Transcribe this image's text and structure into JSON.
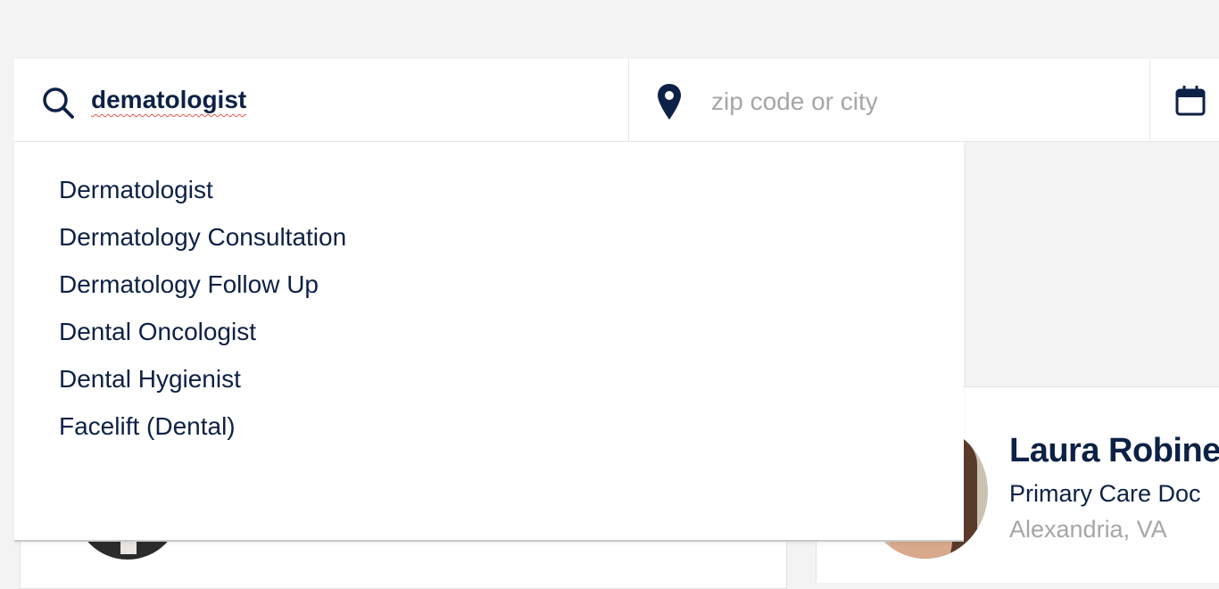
{
  "search": {
    "query": "dematologist",
    "location_placeholder": "zip code or city",
    "location_value": ""
  },
  "suggestions": [
    "Dermatologist",
    "Dermatology Consultation",
    "Dermatology Follow Up",
    "Dental Oncologist",
    "Dental Hygienist",
    "Facelift (Dental)"
  ],
  "provider_card": {
    "name": "Laura Robinet",
    "specialty": "Primary Care Doc",
    "location": "Alexandria, VA"
  },
  "colors": {
    "brand_navy": "#0d2146",
    "placeholder_gray": "#a6a6a6",
    "page_background": "#f3f3f3",
    "spellcheck_red": "#e0584a"
  },
  "icons": {
    "query": "search-icon",
    "location": "map-pin-icon",
    "date": "calendar-icon"
  }
}
